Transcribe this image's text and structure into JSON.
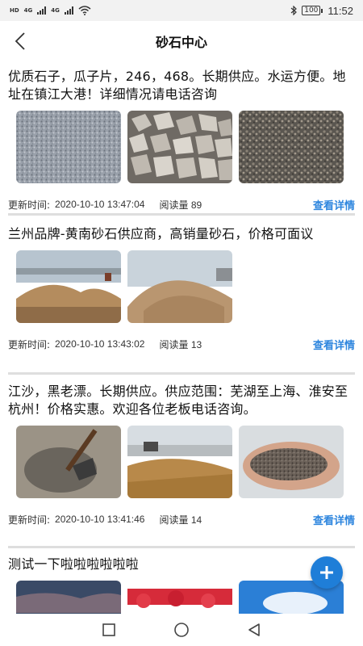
{
  "status_bar": {
    "left_tags": [
      "HD",
      "4G",
      "4G"
    ],
    "battery": "100",
    "time": "11:52"
  },
  "header": {
    "title": "砂石中心",
    "back_icon": "chevron-left-icon"
  },
  "posts": [
    {
      "text": "优质石子，瓜子片，246，468。长期供应。水运方便。地址在镇江大港！详细情况请电话咨询",
      "time_label": "更新时间:",
      "time": "2020-10-10 13:47:04",
      "reads": "阅读量 89",
      "detail_label": "查看详情"
    },
    {
      "text": "兰州品牌-黄南砂石供应商，高销量砂石，价格可面议",
      "time_label": "更新时间:",
      "time": "2020-10-10 13:43:02",
      "reads": "阅读量 13",
      "detail_label": "查看详情"
    },
    {
      "text": "江沙，黑老漂。长期供应。供应范围：芜湖至上海、淮安至杭州！价格实惠。欢迎各位老板电话咨询。",
      "time_label": "更新时间:",
      "time": "2020-10-10 13:41:46",
      "reads": "阅读量 14",
      "detail_label": "查看详情"
    },
    {
      "text": "测试一下啦啦啦啦啦啦"
    }
  ],
  "fab": {
    "icon": "plus-icon"
  },
  "system_nav": {
    "icons": [
      "recent-apps-icon",
      "home-icon",
      "back-triangle-icon"
    ]
  },
  "colors": {
    "accent": "#2e86de",
    "fab": "#1f7ed8",
    "divider": "#dedede"
  }
}
